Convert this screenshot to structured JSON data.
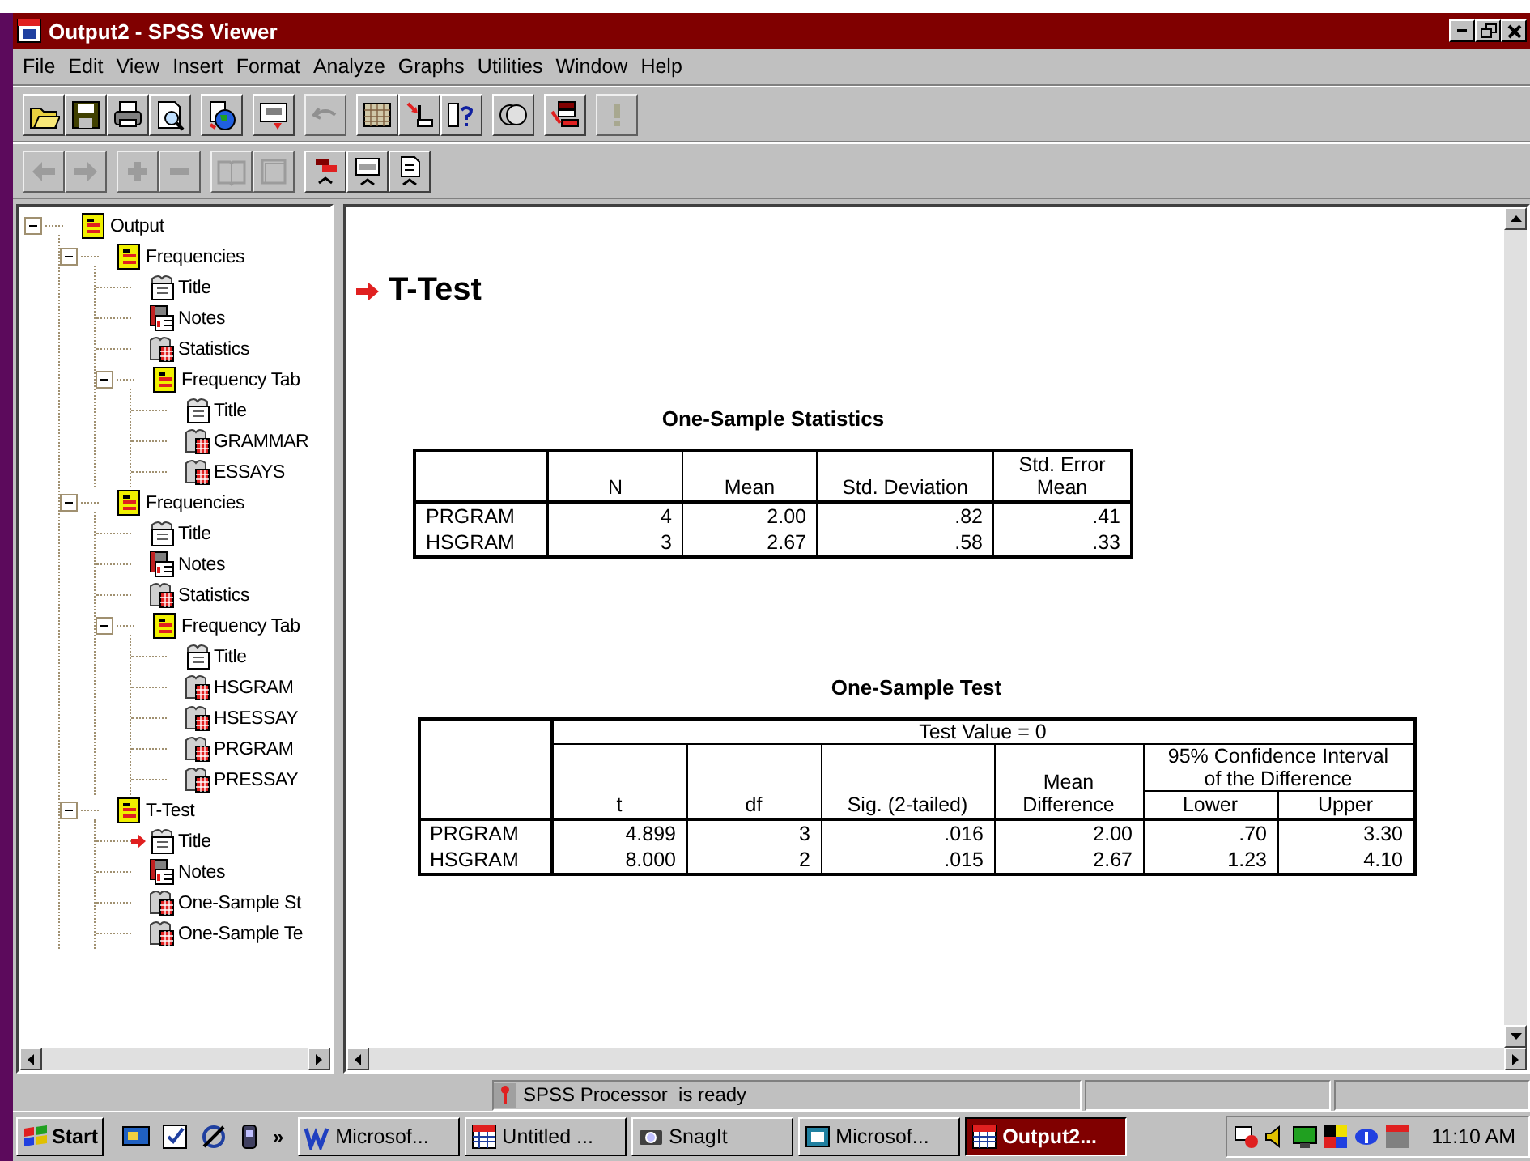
{
  "window": {
    "title": "Output2 - SPSS Viewer"
  },
  "menu": [
    "File",
    "Edit",
    "View",
    "Insert",
    "Format",
    "Analyze",
    "Graphs",
    "Utilities",
    "Window",
    "Help"
  ],
  "toolbar_1": [
    [
      {
        "kind": "folder",
        "disabled": false
      },
      {
        "kind": "disk",
        "disabled": false
      },
      {
        "kind": "printer",
        "disabled": false
      },
      {
        "kind": "preview",
        "disabled": false
      }
    ],
    [
      {
        "kind": "globe",
        "disabled": false
      }
    ],
    [
      {
        "kind": "monitor",
        "disabled": false
      }
    ],
    [
      {
        "kind": "undo",
        "disabled": true
      }
    ],
    [
      {
        "kind": "grid",
        "disabled": false
      },
      {
        "kind": "insert",
        "disabled": false
      },
      {
        "kind": "help",
        "disabled": false
      }
    ],
    [
      {
        "kind": "circles",
        "disabled": false
      }
    ],
    [
      {
        "kind": "select",
        "disabled": false
      }
    ],
    [
      {
        "kind": "exclaim",
        "disabled": true
      }
    ]
  ],
  "toolbar_2": [
    [
      {
        "kind": "left",
        "disabled": true
      },
      {
        "kind": "right",
        "disabled": true
      }
    ],
    [
      {
        "kind": "plus",
        "disabled": true
      },
      {
        "kind": "minus",
        "disabled": true
      }
    ],
    [
      {
        "kind": "book",
        "disabled": true
      },
      {
        "kind": "page",
        "disabled": true
      }
    ],
    [
      {
        "kind": "promote",
        "disabled": false
      },
      {
        "kind": "monitor-up",
        "disabled": false
      },
      {
        "kind": "page-up",
        "disabled": false
      }
    ]
  ],
  "outline": [
    {
      "label": "Output",
      "kind": "book",
      "expanded": true,
      "current": false,
      "children": [
        {
          "label": "Frequencies",
          "kind": "book",
          "expanded": true,
          "current": false,
          "children": [
            {
              "label": "Title",
              "kind": "title",
              "current": false
            },
            {
              "label": "Notes",
              "kind": "notes",
              "current": false
            },
            {
              "label": "Statistics",
              "kind": "table",
              "current": false
            },
            {
              "label": "Frequency Tab",
              "kind": "book",
              "expanded": true,
              "current": false,
              "children": [
                {
                  "label": "Title",
                  "kind": "title",
                  "current": false
                },
                {
                  "label": "GRAMMAR",
                  "kind": "table",
                  "current": false
                },
                {
                  "label": "ESSAYS",
                  "kind": "table",
                  "current": false
                }
              ]
            }
          ]
        },
        {
          "label": "Frequencies",
          "kind": "book",
          "expanded": true,
          "current": false,
          "children": [
            {
              "label": "Title",
              "kind": "title",
              "current": false
            },
            {
              "label": "Notes",
              "kind": "notes",
              "current": false
            },
            {
              "label": "Statistics",
              "kind": "table",
              "current": false
            },
            {
              "label": "Frequency Tab",
              "kind": "book",
              "expanded": true,
              "current": false,
              "children": [
                {
                  "label": "Title",
                  "kind": "title",
                  "current": false
                },
                {
                  "label": "HSGRAM",
                  "kind": "table",
                  "current": false
                },
                {
                  "label": "HSESSAY",
                  "kind": "table",
                  "current": false
                },
                {
                  "label": "PRGRAM",
                  "kind": "table",
                  "current": false
                },
                {
                  "label": "PRESSAY",
                  "kind": "table",
                  "current": false
                }
              ]
            }
          ]
        },
        {
          "label": "T-Test",
          "kind": "book",
          "expanded": true,
          "current": false,
          "children": [
            {
              "label": "Title",
              "kind": "title",
              "current": true
            },
            {
              "label": "Notes",
              "kind": "notes",
              "current": false
            },
            {
              "label": "One-Sample St",
              "kind": "table",
              "current": false
            },
            {
              "label": "One-Sample Te",
              "kind": "table",
              "current": false
            }
          ]
        }
      ]
    }
  ],
  "content": {
    "heading": "T-Test",
    "tables": [
      {
        "title": "One-Sample Statistics",
        "columns": [
          "N",
          "Mean",
          "Std. Deviation",
          "Std. Error Mean"
        ],
        "rows": [
          {
            "label": "PRGRAM",
            "values": [
              "4",
              "2.00",
              ".82",
              ".41"
            ]
          },
          {
            "label": "HSGRAM",
            "values": [
              "3",
              "2.67",
              ".58",
              ".33"
            ]
          }
        ]
      },
      {
        "title": "One-Sample Test",
        "group": "Test Value = 0",
        "columns": [
          "t",
          "df",
          "Sig. (2-tailed)",
          "Mean Difference",
          {
            "group": "95% Confidence Interval of the Difference",
            "columns": [
              "Lower",
              "Upper"
            ]
          }
        ],
        "rows": [
          {
            "label": "PRGRAM",
            "values": [
              "4.899",
              "3",
              ".016",
              "2.00",
              ".70",
              "3.30"
            ]
          },
          {
            "label": "HSGRAM",
            "values": [
              "8.000",
              "2",
              ".015",
              "2.67",
              "1.23",
              "4.10"
            ]
          }
        ]
      }
    ]
  },
  "status_bar": {
    "message": "SPSS Processor  is ready"
  },
  "taskbar": {
    "start": "Start",
    "more": "»",
    "tasks": [
      {
        "label": "Microsof...",
        "kind": "word",
        "selected": false
      },
      {
        "label": "Untitled ...",
        "kind": "data",
        "selected": false
      },
      {
        "label": "SnagIt",
        "kind": "camera",
        "selected": false
      },
      {
        "label": "Microsof...",
        "kind": "screen",
        "selected": false
      },
      {
        "label": "Output2...",
        "kind": "data",
        "selected": true
      }
    ],
    "clock": "11:10 AM"
  }
}
